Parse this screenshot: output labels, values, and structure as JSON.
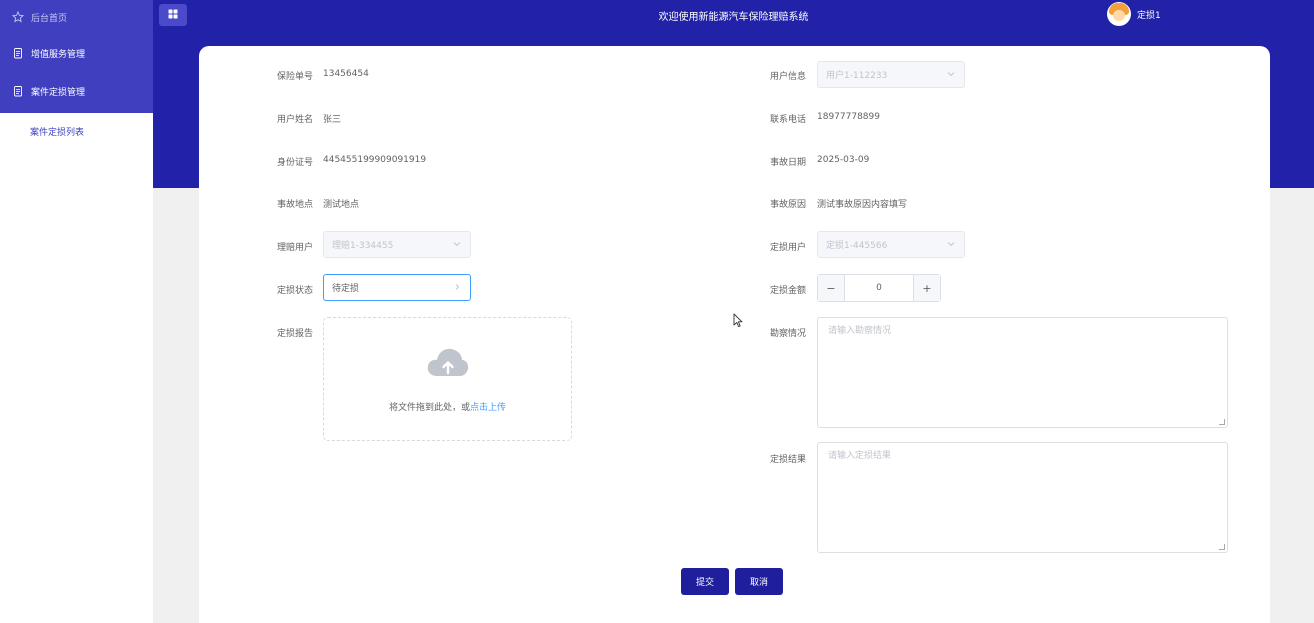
{
  "sidebar": {
    "home_label": "后台首页",
    "items": [
      {
        "label": "增值服务管理"
      },
      {
        "label": "案件定损管理"
      }
    ],
    "sub_items": [
      {
        "label": "案件定损列表"
      }
    ]
  },
  "header": {
    "title": "欢迎使用新能源汽车保险理赔系统",
    "username": "定损1"
  },
  "form": {
    "policy_no": {
      "label": "保险单号",
      "value": "13456454"
    },
    "user_info": {
      "label": "用户信息",
      "value": "用户1-112233"
    },
    "user_name": {
      "label": "用户姓名",
      "value": "张三"
    },
    "phone": {
      "label": "联系电话",
      "value": "18977778899"
    },
    "id_no": {
      "label": "身份证号",
      "value": "445455199909091919"
    },
    "accident_date": {
      "label": "事故日期",
      "value": "2025-03-09"
    },
    "accident_place": {
      "label": "事故地点",
      "value": "测试地点"
    },
    "accident_reason": {
      "label": "事故原因",
      "value": "测试事故原因内容填写"
    },
    "claim_user": {
      "label": "理赔用户",
      "value": "理赔1-334455"
    },
    "assess_user": {
      "label": "定损用户",
      "value": "定损1-445566"
    },
    "assess_status": {
      "label": "定损状态",
      "value": "待定损"
    },
    "assess_amount": {
      "label": "定损金额",
      "value": "0",
      "minus": "−",
      "plus": "+"
    },
    "assess_report": {
      "label": "定损报告",
      "upload_text": "将文件拖到此处，或",
      "upload_link": "点击上传"
    },
    "survey": {
      "label": "勘察情况",
      "placeholder": "请输入勘察情况"
    },
    "assess_result": {
      "label": "定损结果",
      "placeholder": "请输入定损结果"
    }
  },
  "actions": {
    "submit": "提交",
    "cancel": "取消"
  },
  "colors": {
    "header_bg": "#2222a8",
    "sidebar_active": "#3f3fbf",
    "primary_button": "#1f1f9e",
    "link": "#409eff"
  }
}
